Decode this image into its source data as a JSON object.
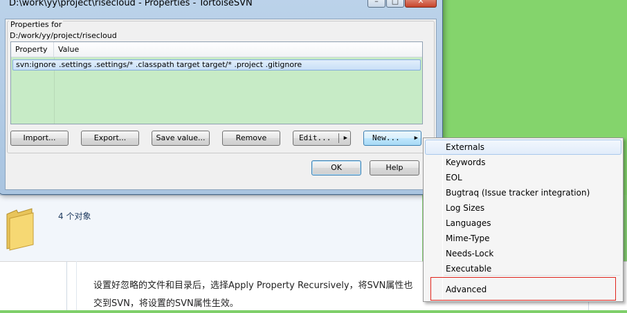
{
  "dialog": {
    "title": "D:\\work\\yy\\project\\risecloud - Properties - TortoiseSVN",
    "window_buttons": {
      "minimize": "–",
      "maximize": "□",
      "close": "✕"
    },
    "group_label": "Properties for",
    "path": "D:/work/yy/project/risecloud",
    "list": {
      "columns": [
        "Property",
        "Value"
      ],
      "rows": [
        {
          "property": "svn:ignore",
          "value": ".settings .settings/* .classpath target target/* .project .gitignore"
        }
      ]
    },
    "buttons": {
      "import": "Import...",
      "export": "Export...",
      "save_value": "Save value...",
      "remove": "Remove",
      "edit": "Edit...",
      "new": "New...",
      "ok": "OK",
      "help": "Help"
    }
  },
  "menu": {
    "items": [
      {
        "label": "Externals"
      },
      {
        "label": "Keywords"
      },
      {
        "label": "EOL"
      },
      {
        "label": "Bugtraq (Issue tracker integration)"
      },
      {
        "label": "Log Sizes"
      },
      {
        "label": "Languages"
      },
      {
        "label": "Mime-Type"
      },
      {
        "label": "Needs-Lock"
      },
      {
        "label": "Executable"
      },
      {
        "label": "Advanced"
      }
    ],
    "highlighted": "Externals",
    "annotated": "Advanced"
  },
  "explorer": {
    "objects_count": "4 个对象"
  },
  "article": {
    "line1": "设置好忽略的文件和目录后，选择Apply Property Recursively，将SVN属性也",
    "line2": "交到SVN，将设置的SVN属性生效。"
  },
  "colors": {
    "annotation_red": "#e0231a",
    "list_background": "#c7ebc6",
    "selection": "#c9e0f7"
  }
}
